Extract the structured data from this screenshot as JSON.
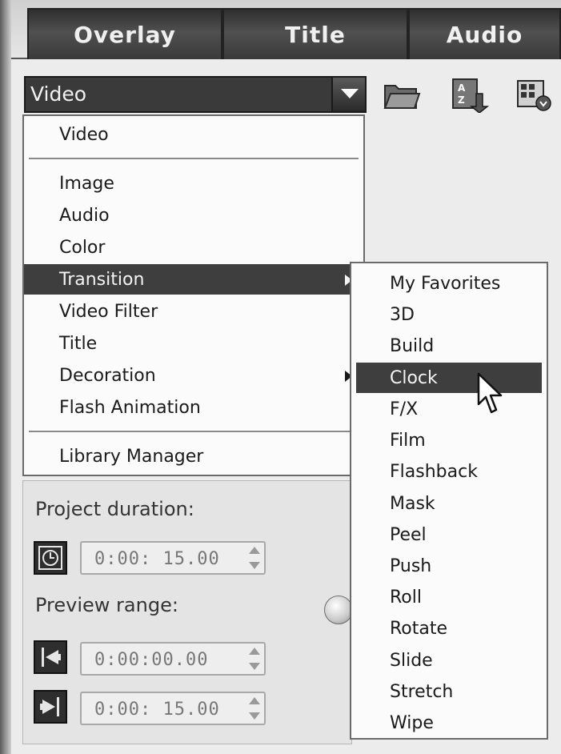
{
  "tabs": [
    {
      "label": "Overlay"
    },
    {
      "label": "Title"
    },
    {
      "label": "Audio"
    }
  ],
  "library": {
    "combo_value": "Video",
    "icons": [
      "folder-open-icon",
      "sort-az-icon",
      "view-options-icon"
    ]
  },
  "menu": {
    "items": [
      "Video",
      "Image",
      "Audio",
      "Color",
      "Transition",
      "Video Filter",
      "Title",
      "Decoration",
      "Flash Animation",
      "Library Manager"
    ],
    "selected": "Transition",
    "submenus": [
      "Transition",
      "Decoration"
    ]
  },
  "submenu": {
    "items": [
      "My Favorites",
      "3D",
      "Build",
      "Clock",
      "F/X",
      "Film",
      "Flashback",
      "Mask",
      "Peel",
      "Push",
      "Roll",
      "Rotate",
      "Slide",
      "Stretch",
      "Wipe"
    ],
    "selected": "Clock"
  },
  "bottom": {
    "project_duration_label": "Project duration:",
    "project_duration_value": "0:00: 15.00",
    "preview_range_label": "Preview range:",
    "preview_start_value": "0:00:00.00",
    "preview_end_value": "0:00: 15.00"
  },
  "colors": {
    "tab_bg": "#3a3a3a",
    "highlight_bg": "#3e3e3e",
    "menu_bg": "#fbfbfb"
  }
}
